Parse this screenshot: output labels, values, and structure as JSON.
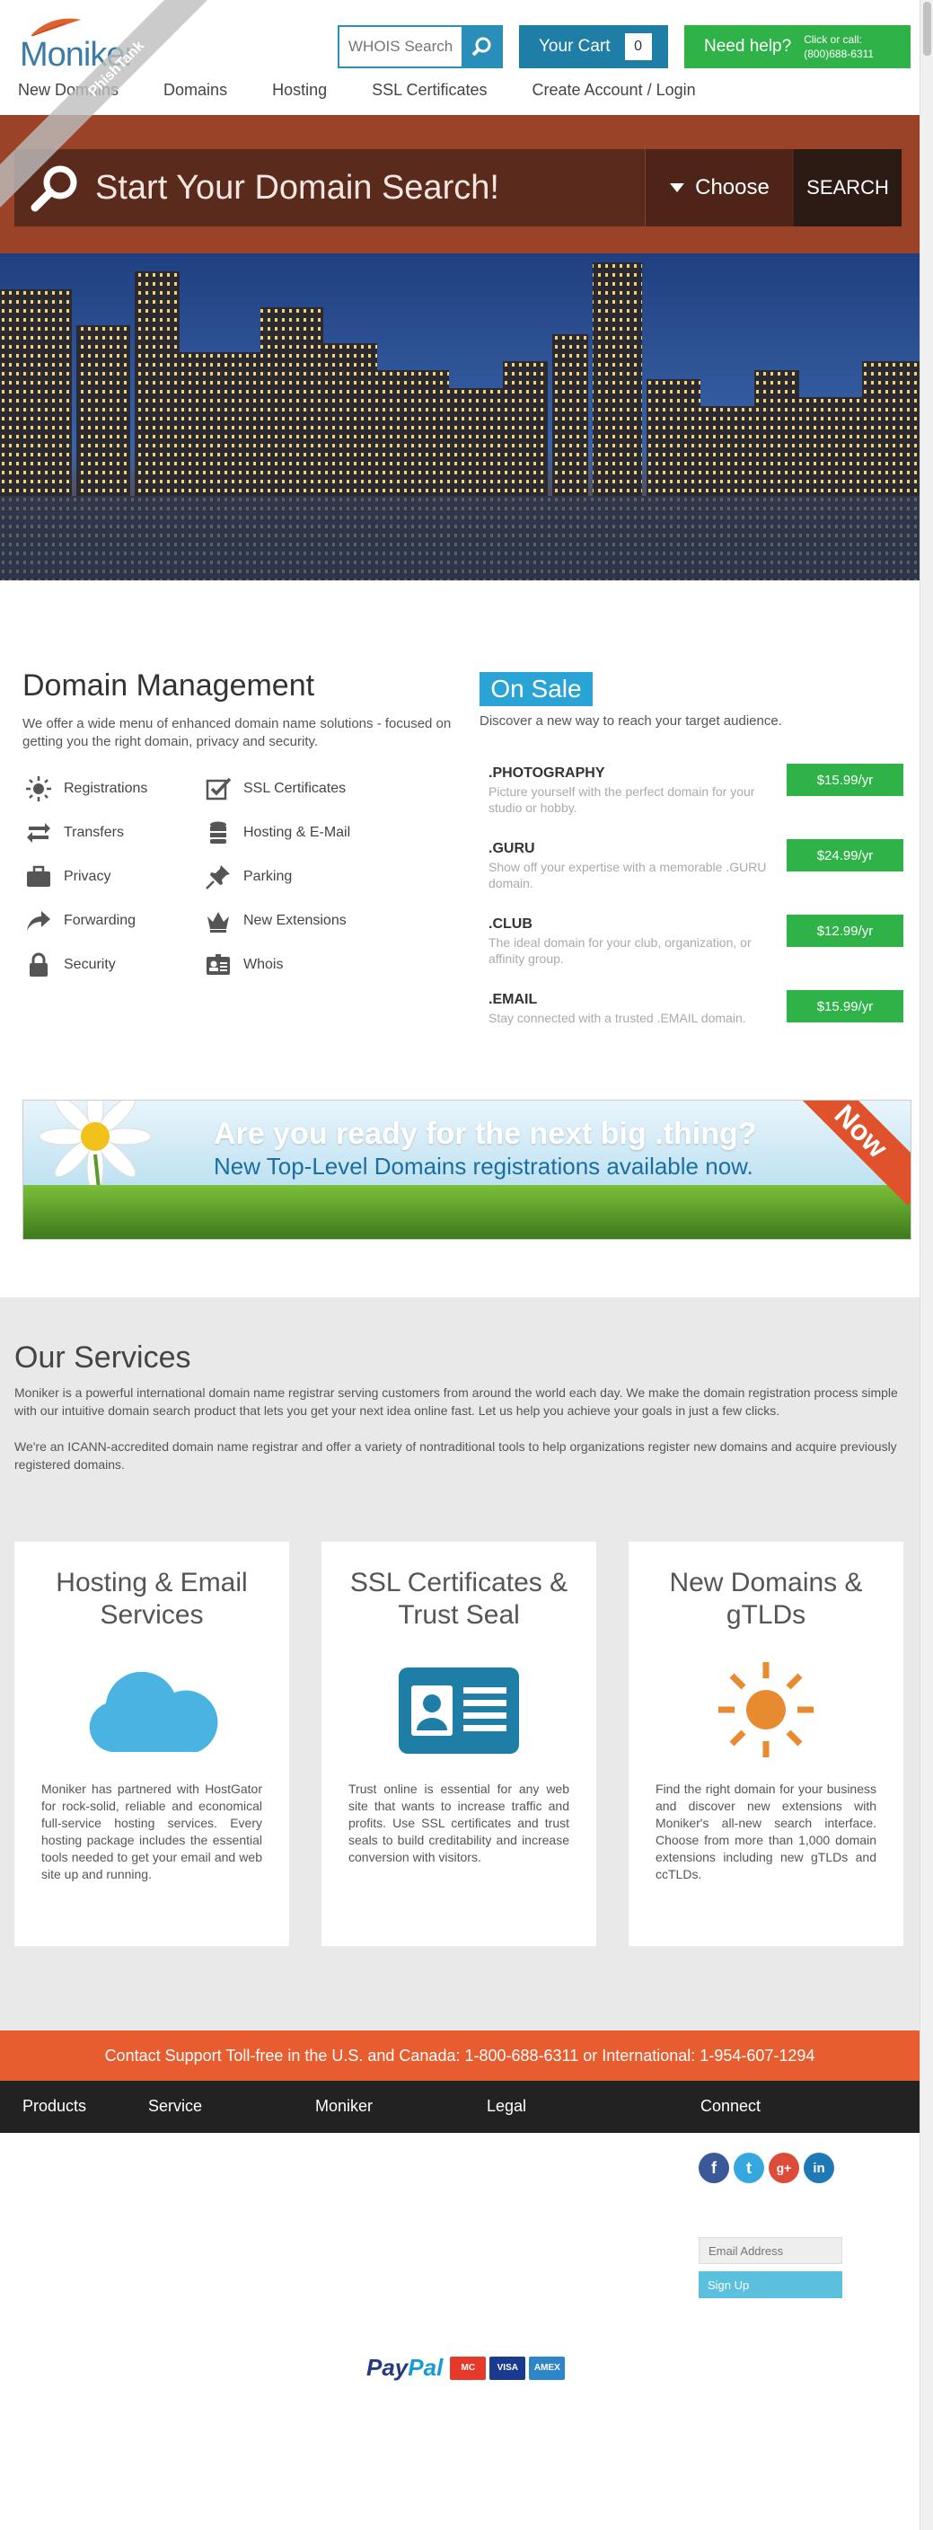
{
  "header": {
    "logo_text": "Moniker",
    "whois_placeholder": "WHOIS Search",
    "cart_label": "Your Cart",
    "cart_count": "0",
    "help_label": "Need help?",
    "help_call": "Click or call:",
    "help_phone": "(800)688-6311",
    "watermark": "PhishTank"
  },
  "nav": [
    "New Domains",
    "Domains",
    "Hosting",
    "SSL Certificates",
    "Create Account / Login"
  ],
  "hero": {
    "search_label": "Start Your Domain Search!",
    "choose_label": "Choose",
    "search_button": "SEARCH"
  },
  "domain_management": {
    "title": "Domain Management",
    "description": "We offer a wide menu of enhanced domain name solutions - focused on getting you the right domain, privacy and security.",
    "features_left": [
      "Registrations",
      "Transfers",
      "Privacy",
      "Forwarding",
      "Security"
    ],
    "features_right": [
      "SSL Certificates",
      "Hosting & E-Mail",
      "Parking",
      "New Extensions",
      "Whois"
    ]
  },
  "on_sale": {
    "badge": "On Sale",
    "description": "Discover a new way to reach your target audience.",
    "items": [
      {
        "tld": ".PHOTOGRAPHY",
        "desc": "Picture yourself with the perfect domain for your studio or hobby.",
        "price": "$15.99/yr"
      },
      {
        "tld": ".GURU",
        "desc": "Show off your expertise with a memorable .GURU domain.",
        "price": "$24.99/yr"
      },
      {
        "tld": ".CLUB",
        "desc": "The ideal domain for your club, organization, or affinity group.",
        "price": "$12.99/yr"
      },
      {
        "tld": ".EMAIL",
        "desc": "Stay connected with a trusted .EMAIL domain.",
        "price": "$15.99/yr"
      }
    ]
  },
  "banner": {
    "line1": "Are you ready for the next big .thing?",
    "line2": "New Top-Level Domains registrations available now.",
    "corner": "Now"
  },
  "services": {
    "title": "Our Services",
    "p1": "Moniker is a powerful international domain name registrar serving customers from around the world each day. We make the domain registration process simple with our intuitive domain search product that lets you get your next idea online fast. Let us help you achieve your goals in just a few clicks.",
    "p2": "We're an ICANN-accredited domain name registrar and offer a variety of nontraditional tools to help organizations register new domains and acquire previously registered domains.",
    "cards": [
      {
        "title": "Hosting & Email Services",
        "text": "Moniker has partnered with HostGator for rock-solid, reliable and economical full-service hosting services. Every hosting package includes the essential tools needed to get your email and web site up and running."
      },
      {
        "title": "SSL Certificates & Trust Seal",
        "text": "Trust online is essential for any web site that wants to increase traffic and profits. Use SSL certificates and trust seals to build creditability and increase conversion with visitors."
      },
      {
        "title": "New Domains & gTLDs",
        "text": "Find the right domain for your business and discover new extensions with Moniker's all-new search interface. Choose from more than 1,000 domain extensions including new gTLDs and ccTLDs."
      }
    ]
  },
  "support": {
    "text": "Contact Support Toll-free in the U.S. and Canada: 1-800-688-6311 or International: 1-954-607-1294"
  },
  "footer": {
    "nav": [
      "Products",
      "Service",
      "Moniker",
      "Legal",
      "Connect"
    ],
    "social": [
      "f",
      "t",
      "g+",
      "in"
    ],
    "email_placeholder": "Email Address",
    "signup": "Sign Up",
    "paypal_a": "Pay",
    "paypal_b": "Pal",
    "cards": [
      "MC",
      "VISA",
      "AMEX"
    ]
  },
  "colors": {
    "brand_blue": "#2a8fb8",
    "green": "#2fb349",
    "orange": "#e85d2f",
    "rust": "#9b4328"
  }
}
